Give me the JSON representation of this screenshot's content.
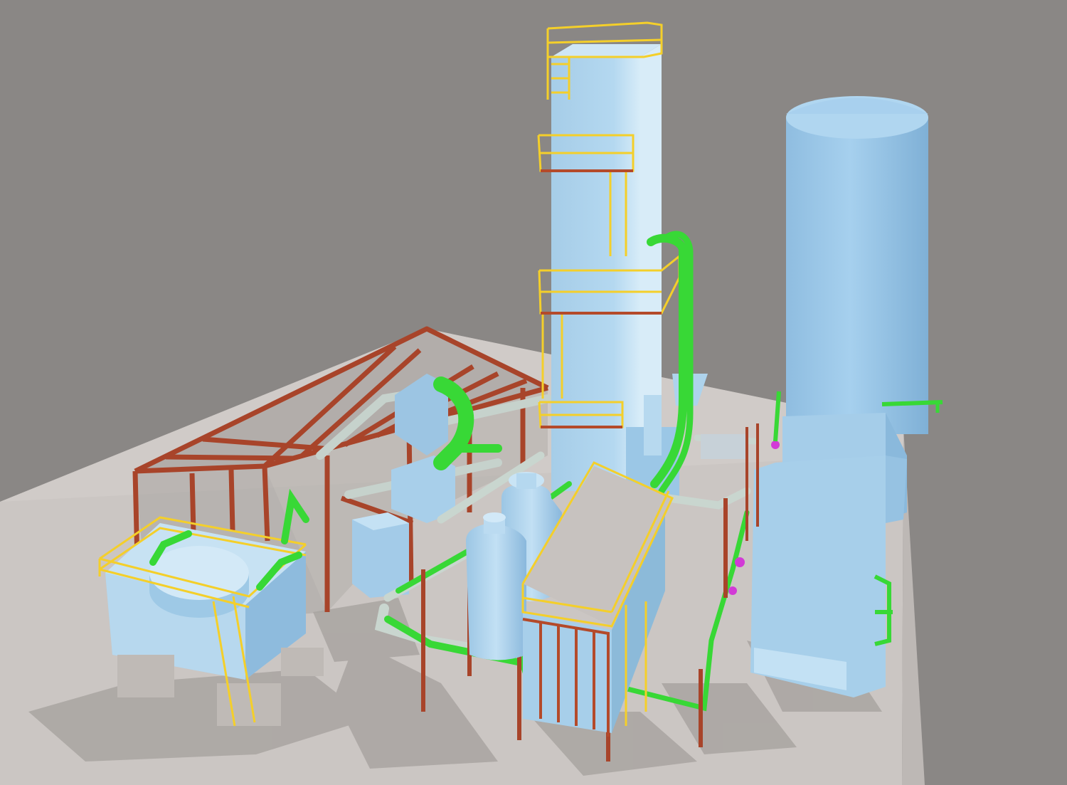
{
  "scene": {
    "background_color": "#8a8785",
    "ground_color": "#c9c4c2",
    "equipment_color": "#a9cfea",
    "equipment_shade_color": "#86b3d6",
    "pipe_green_color": "#3ee23a",
    "pipe_grey_color": "#c9d6cf",
    "structure_red_color": "#a8442a",
    "railing_yellow_color": "#f4cf2a",
    "shadow_color": "#9e9995"
  }
}
